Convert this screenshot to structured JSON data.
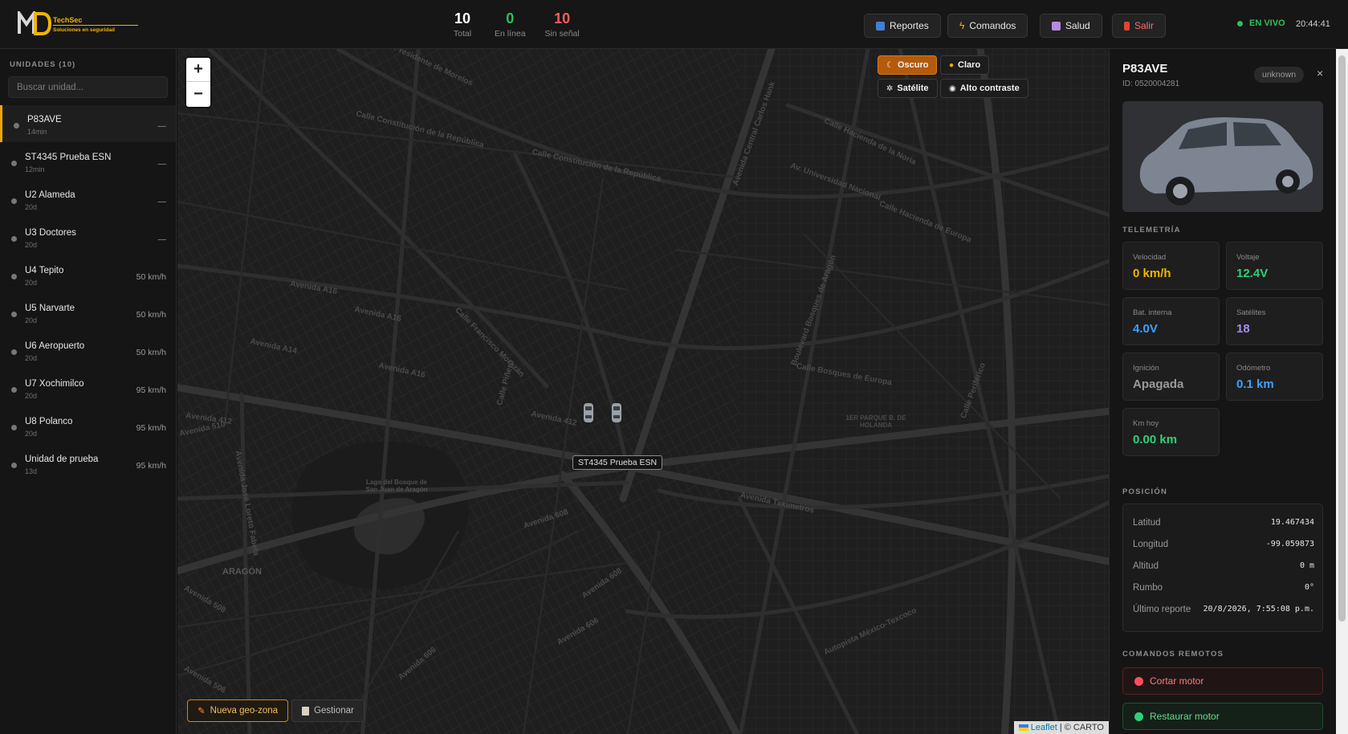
{
  "header": {
    "logo": {
      "mark": "MD",
      "brand": "TechSec",
      "tagline": "Soluciones en seguridad"
    },
    "stats": [
      {
        "value": "10",
        "label": "Total",
        "color": "#ffffff"
      },
      {
        "value": "0",
        "label": "En línea",
        "color": "#2fbf5a"
      },
      {
        "value": "10",
        "label": "Sin señal",
        "color": "#ff5c5c"
      }
    ],
    "buttons": {
      "reportes": "Reportes",
      "comandos": "Comandos",
      "salud": "Salud",
      "salir": "Salir"
    },
    "live_label": "EN VIVO",
    "clock": "20:44:41"
  },
  "sidebar": {
    "title": "UNIDADES (10)",
    "search_placeholder": "Buscar unidad...",
    "units": [
      {
        "name": "P83AVE",
        "ago": "14min",
        "speed": "—",
        "active": true
      },
      {
        "name": "ST4345 Prueba ESN",
        "ago": "12min",
        "speed": "—"
      },
      {
        "name": "U2 Alameda",
        "ago": "20d",
        "speed": "—"
      },
      {
        "name": "U3 Doctores",
        "ago": "20d",
        "speed": "—"
      },
      {
        "name": "U4 Tepito",
        "ago": "20d",
        "speed": "50 km/h"
      },
      {
        "name": "U5 Narvarte",
        "ago": "20d",
        "speed": "50 km/h"
      },
      {
        "name": "U6 Aeropuerto",
        "ago": "20d",
        "speed": "50 km/h"
      },
      {
        "name": "U7 Xochimilco",
        "ago": "20d",
        "speed": "95 km/h"
      },
      {
        "name": "U8 Polanco",
        "ago": "20d",
        "speed": "95 km/h"
      },
      {
        "name": "Unidad de prueba",
        "ago": "13d",
        "speed": "95 km/h"
      }
    ]
  },
  "map": {
    "zoom_in": "+",
    "zoom_out": "−",
    "layers": {
      "dark": "Oscuro",
      "light": "Claro",
      "satellite": "Satélite",
      "contrast": "Alto contraste"
    },
    "tooltip": "ST4345 Prueba ESN",
    "labels": {
      "aragon": "ARAGÓN",
      "parque": "1ER PARQUE B. DE HOLANDA",
      "lago": "Lago del Bosque de San Juan de Aragón",
      "streets": [
        "Avenida 412",
        "Avenida 412",
        "Avenida 608",
        "Avenida 608",
        "Avenida 606",
        "Avenida 606",
        "Avenida 510",
        "Avenida 508",
        "Avenida 506",
        "Avenida A16",
        "Avenida A14",
        "Avenida A16",
        "Avenida A16",
        "Calle Constitución de la República",
        "Calle Constitución de la República",
        "Avenida Central Carlos Hank",
        "Calle Hacienda de la Noria",
        "Av. Universidad Nacional",
        "Calle Hacienda de Europa",
        "Boulevard Bosques de Aragón",
        "Calle Bosques de Europa",
        "Avenida Taximetros",
        "Autopista México-Texcoco",
        "Calle Periférico",
        "Avenida José Loreto Fabela",
        "Calle Francisco Morazán",
        "Calle Piñero",
        "Calle Presidente de Morelos"
      ]
    },
    "geo_new": "Nueva geo-zona",
    "geo_manage": "Gestionar",
    "attribution_leaflet": "Leaflet",
    "attribution_rest": "| © CARTO"
  },
  "panel": {
    "title": "P83AVE",
    "id": "ID: 0520004281",
    "badge": "unknown",
    "close": "×",
    "telemetry_title": "TELEMETRÍA",
    "telemetry": [
      {
        "label": "Velocidad",
        "value": "0 km/h",
        "color": "#f0b400"
      },
      {
        "label": "Voltaje",
        "value": "12.4V",
        "color": "#2fd07a"
      },
      {
        "label": "Bat. interna",
        "value": "4.0V",
        "color": "#3fa0ff"
      },
      {
        "label": "Satélites",
        "value": "18",
        "color": "#a78bfa"
      },
      {
        "label": "Ignición",
        "value": "Apagada",
        "color": "#9a9a9a"
      },
      {
        "label": "Odómetro",
        "value": "0.1 km",
        "color": "#3fa0ff"
      },
      {
        "label": "Km hoy",
        "value": "0.00 km",
        "color": "#2fd07a"
      }
    ],
    "position_title": "POSICIÓN",
    "position": [
      {
        "label": "Latitud",
        "value": "19.467434"
      },
      {
        "label": "Longitud",
        "value": "-99.059873"
      },
      {
        "label": "Altitud",
        "value": "0 m"
      },
      {
        "label": "Rumbo",
        "value": "0°"
      },
      {
        "label": "Último reporte",
        "value": "20/8/2026, 7:55:08 p.m."
      }
    ],
    "commands_title": "COMANDOS REMOTOS",
    "commands": {
      "cut": "Cortar motor",
      "restore": "Restaurar motor"
    }
  }
}
